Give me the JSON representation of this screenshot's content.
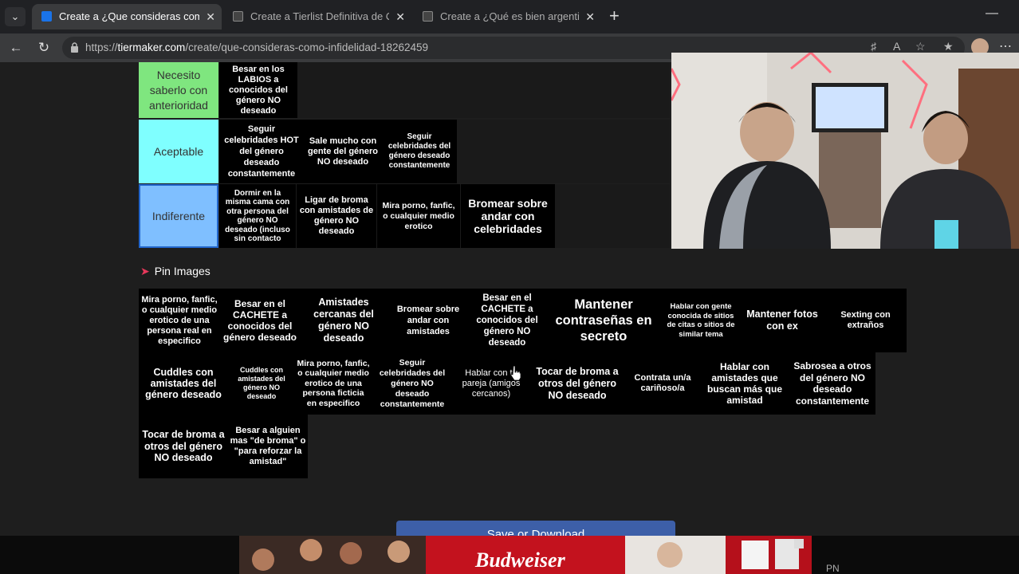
{
  "browser": {
    "tabs": [
      {
        "title": "Create a ¿Que consideras como infidelidad",
        "active": true
      },
      {
        "title": "Create a Tierlist Definitiva de Comedia",
        "active": false
      },
      {
        "title": "Create a ¿Qué es bien argentino y qué",
        "active": false
      }
    ],
    "url_prefix": "https://",
    "url_domain": "tiermaker.com",
    "url_path": "/create/que-consideras-como-infidelidad-18262459"
  },
  "tiers": [
    {
      "label": "Necesito saberlo con anterioridad",
      "color": "#7fe67f",
      "items": [
        "Besar en los LABIOS a conocidos del género NO deseado"
      ]
    },
    {
      "label": "Aceptable",
      "color": "#7fffff",
      "items": [
        "Seguir celebridades HOT del género deseado constantemente",
        "Sale mucho con gente del género NO deseado",
        "Seguir celebridades del género deseado constantemente"
      ]
    },
    {
      "label": "Indiferente",
      "color": "#7fbfff",
      "items": [
        "Dormir en la misma cama con otra persona del género NO deseado (incluso sin contacto",
        "Ligar de broma con amistades de género NO deseado",
        "Mira porno, fanfic, o cualquier medio erotico",
        "Bromear sobre andar con celebridades"
      ]
    }
  ],
  "pin_images": {
    "label": "Pin Images",
    "items": [
      "Mira porno, fanfic, o cualquier medio erotico de una persona real en especifico",
      "Besar en el CACHETE a conocidos del género deseado",
      "Amistades cercanas del género NO deseado",
      "Bromear sobre andar con amistades",
      "Besar en el CACHETE a conocidos del género NO deseado",
      "Mantener contraseñas en secreto",
      "Hablar con gente conocida de sitios de citas o sitios de similar tema",
      "Mantener fotos con ex",
      "Sexting con extraños",
      "Cuddles con amistades del género deseado",
      "Cuddles con amistades del género NO deseado",
      "Mira porno, fanfic, o cualquier medio erotico de una persona ficticia en especifico",
      "Seguir celebridades del género NO deseado constantemente",
      "Hablar con tu pareja (amigos cercanos)",
      "Tocar de broma a otros del género NO deseado",
      "Contrata un/a cariñoso/a",
      "Hablar con amistades que buscan más que amistad",
      "Sabrosea a otros del género NO deseado constantemente",
      "Tocar de broma a otros del género NO deseado",
      "Besar a alguien mas \"de broma\" o \"para reforzar la amistad\""
    ]
  },
  "save_button": "Save or Download",
  "ad": {
    "brand": "Budweiser",
    "corner": "PN"
  }
}
